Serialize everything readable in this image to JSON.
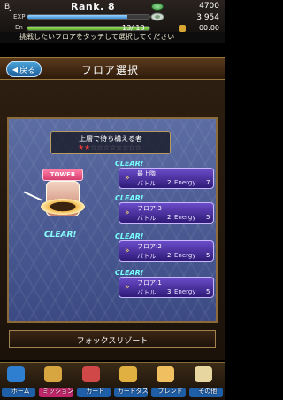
{
  "status": {
    "name": "BJ",
    "rank": "Rank. 8",
    "coins": "4700",
    "exp_label": "EXP",
    "exp_progress": 0.82,
    "money": "3,954",
    "en_label": "En",
    "energy": "13/ 13",
    "energy_progress": 1.0,
    "timer": "00:00"
  },
  "instruction": "挑戦したいフロアをタッチして選択してください",
  "header": {
    "back_label": "戻る",
    "title": "フロア選択"
  },
  "boss": {
    "title": "上層で待ち構える者",
    "stars": "★★☆☆☆☆☆☆☆☆",
    "stars_filled": 2,
    "stars_total": 10
  },
  "tower": {
    "sign": "TOWER",
    "clear": "CLEAR!"
  },
  "floors": [
    {
      "clear": "CLEAR!",
      "name": "最上階",
      "battle_label": "バトル",
      "battles": "2",
      "energy_label": "Energy",
      "energy": "7"
    },
    {
      "clear": "CLEAR!",
      "name": "フロア:3",
      "battle_label": "バトル",
      "battles": "2",
      "energy_label": "Energy",
      "energy": "5"
    },
    {
      "clear": "CLEAR!",
      "name": "フロア:2",
      "battle_label": "バトル",
      "battles": "2",
      "energy_label": "Energy",
      "energy": "5"
    },
    {
      "clear": "CLEAR!",
      "name": "フロア:1",
      "battle_label": "バトル",
      "battles": "3",
      "energy_label": "Energy",
      "energy": "5"
    }
  ],
  "location": "フォックスリゾート",
  "nav": [
    {
      "label": "ホーム",
      "icon": "home-icon",
      "color": "#2f7fd0",
      "tag": "#1f5fa8"
    },
    {
      "label": "ミッション",
      "icon": "mission-icon",
      "color": "#d8a640",
      "tag": "#c2266a"
    },
    {
      "label": "カード",
      "icon": "card-icon",
      "color": "#d04848",
      "tag": "#1f5fa8"
    },
    {
      "label": "カードダス",
      "icon": "carddass-icon",
      "color": "#e0b040",
      "tag": "#1f5fa8"
    },
    {
      "label": "フレンド",
      "icon": "friend-icon",
      "color": "#f0c060",
      "tag": "#1f5fa8"
    },
    {
      "label": "その他",
      "icon": "other-icon",
      "color": "#e8d6a0",
      "tag": "#1f5fa8"
    }
  ]
}
